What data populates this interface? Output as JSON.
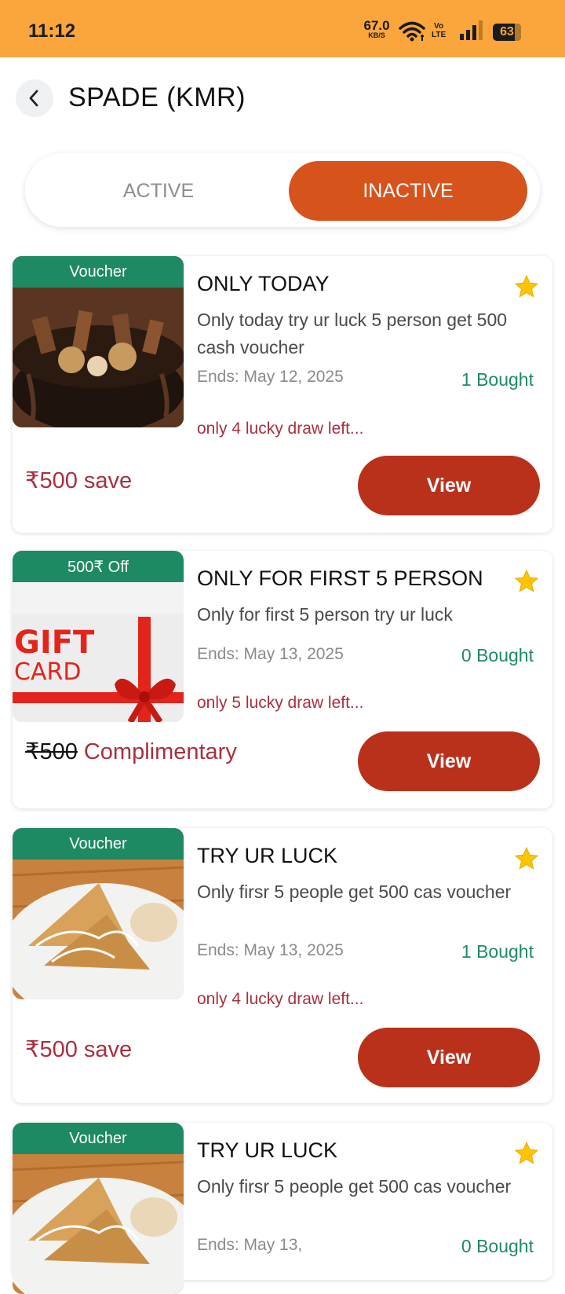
{
  "status_bar": {
    "time": "11:12",
    "net_speed": "67.0",
    "net_unit": "KB/S",
    "volte_top": "Vo",
    "volte_bottom": "LTE",
    "battery": "63"
  },
  "header": {
    "title": "SPADE (KMR)",
    "back_icon": "chevron-left-icon"
  },
  "tabs": [
    {
      "label": "ACTIVE",
      "selected": false
    },
    {
      "label": "INACTIVE",
      "selected": true
    }
  ],
  "colors": {
    "status_bar": "#fba63c",
    "tab_selected": "#d6531c",
    "ribbon": "#1e8a63",
    "view_button": "#b9311b",
    "accent_red": "#a8303e"
  },
  "cards": [
    {
      "ribbon": "Voucher",
      "title": "ONLY TODAY",
      "description": "Only today try ur luck 5 person get 500 cash voucher",
      "ends": "Ends: May 12, 2025",
      "bought": "1 Bought",
      "draws_left": "only 4 lucky draw left...",
      "price": "₹500 save",
      "button": "View",
      "image": "chocolate-cake"
    },
    {
      "ribbon": "500₹ Off",
      "title": "ONLY FOR FIRST 5 PERSON",
      "description": "Only for first 5 person try ur luck",
      "ends": "Ends: May 13, 2025",
      "bought": "0 Bought",
      "draws_left": "only 5 lucky draw left...",
      "price_strike": "₹500",
      "price": "Complimentary",
      "button": "View",
      "image": "gift-card",
      "gift_top": "GIFT",
      "gift_bottom": "CARD"
    },
    {
      "ribbon": "Voucher",
      "title": "TRY UR LUCK",
      "description": "Only firsr 5 people get 500 cas voucher",
      "ends": "Ends: May 13, 2025",
      "bought": "1 Bought",
      "draws_left": "only 4 lucky draw left...",
      "price": "₹500 save",
      "button": "View",
      "image": "sandwich-plate"
    },
    {
      "ribbon": "Voucher",
      "title": "TRY UR LUCK",
      "description": "Only firsr 5 people get 500 cas voucher",
      "ends": "Ends: May 13,",
      "bought": "0 Bought",
      "image": "sandwich-plate"
    }
  ]
}
